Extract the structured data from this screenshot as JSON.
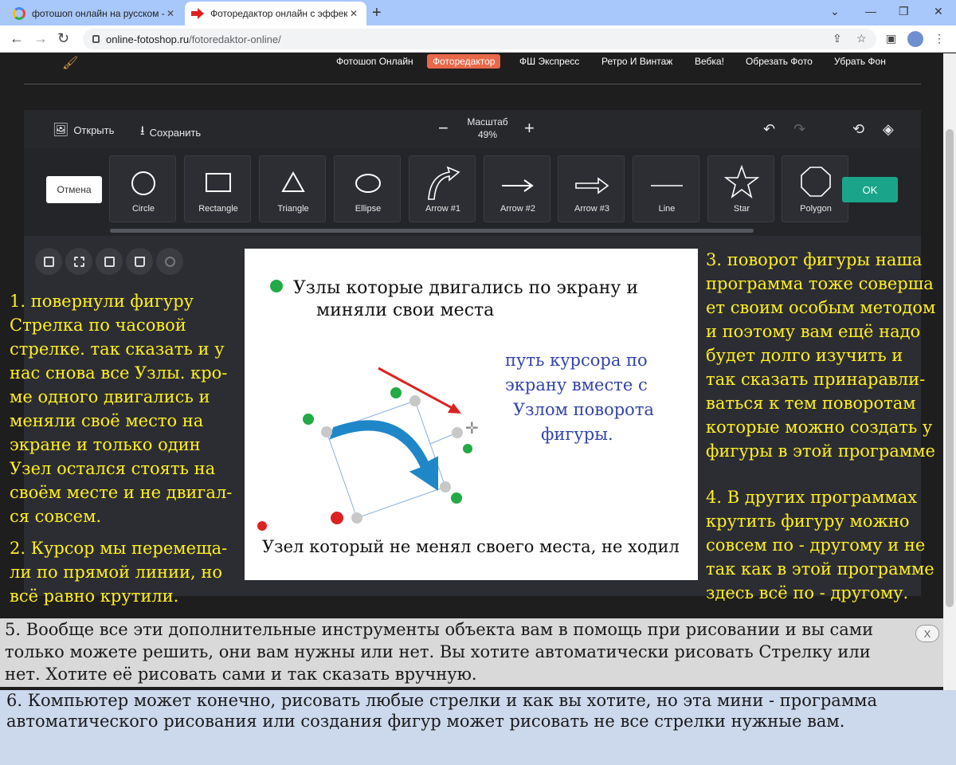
{
  "browser": {
    "tabs": [
      {
        "title": "фотошоп онлайн на русском - П",
        "active": false
      },
      {
        "title": "Фоторедактор онлайн с эффект",
        "active": true
      }
    ],
    "url_host": "online-fotoshop.ru",
    "url_path": "/fotoredaktor-online/"
  },
  "site_nav": {
    "links": [
      "Фотошоп Онлайн",
      "Фоторедактор",
      "ФШ Экспресс",
      "Ретро И Винтаж",
      "Вебка!",
      "Обрезать Фото",
      "Убрать Фон"
    ],
    "active": "Фоторедактор"
  },
  "toolbar": {
    "open_label": "Открыть",
    "save_label": "Сохранить",
    "zoom_title": "Масштаб",
    "zoom_value": "49%"
  },
  "shapes_panel": {
    "cancel_label": "Отмена",
    "ok_label": "OK",
    "shapes": [
      "Circle",
      "Rectangle",
      "Triangle",
      "Ellipse",
      "Arrow #1",
      "Arrow #2",
      "Arrow #3",
      "Line",
      "Star",
      "Polygon"
    ]
  },
  "canvas": {
    "legend_line1": "Узлы которые двигались по экрану и",
    "legend_line2": "миняли свои места",
    "cursor_note": [
      "путь курсора по",
      "экрану вместе с",
      "Узлом поворота",
      "фигуры."
    ],
    "bottom_note": "Узел который не менял своего места, не ходил"
  },
  "notes": {
    "note1": [
      "1. повернули фигуру",
      "Стрелка по часовой",
      "стрелке. так сказать и у",
      "нас снова все Узлы. кро-",
      "ме одного двигались и",
      "меняли своё место на",
      "экране и только один",
      "Узел остался стоять на",
      "своём месте и не двигал-",
      "ся совсем."
    ],
    "note2": [
      "2. Курсор мы перемеща-",
      "ли по прямой линии, но",
      "всё равно крутили."
    ],
    "note3": [
      "3. поворот фигуры наша",
      "программа тоже соверша",
      "ет своим особым методом",
      "и поэтому вам ещё надо",
      "будет долго изучить и",
      "так сказать принаравли-",
      "ваться к тем поворотам",
      "которые можно создать у",
      "фигуры в этой программе"
    ],
    "note4": [
      "4. В других программах",
      "крутить фигуру можно",
      "совсем по - другому и не",
      "так как в этой программе",
      "здесь всё по - другому."
    ],
    "note5": [
      "5. Вообще все эти дополнительные инструменты объекта вам в помощь при рисовании и вы сами",
      "  только можете решить, они вам нужны или нет. Вы хотите автоматически рисовать Стрелку или",
      "нет. Хотите её рисовать сами и так сказать вручную."
    ],
    "note6": [
      "6. Компьютер может конечно, рисовать любые стрелки и как вы хотите, но эта мини - программа",
      "автоматического рисования или создания фигур может рисовать не все стрелки нужные вам."
    ],
    "close_label": "X"
  },
  "colors": {
    "accent_nav": "#e8684a",
    "ok_button": "#1aa58a",
    "note_text": "#ffee22",
    "cursor_note": "#3344aa",
    "moved_node": "#22aa44",
    "fixed_node": "#dd2222"
  },
  "icons": {
    "open": "image-icon",
    "save": "download-icon",
    "undo": "undo-icon",
    "redo": "redo-icon",
    "history": "history-icon",
    "layers": "layers-icon"
  }
}
